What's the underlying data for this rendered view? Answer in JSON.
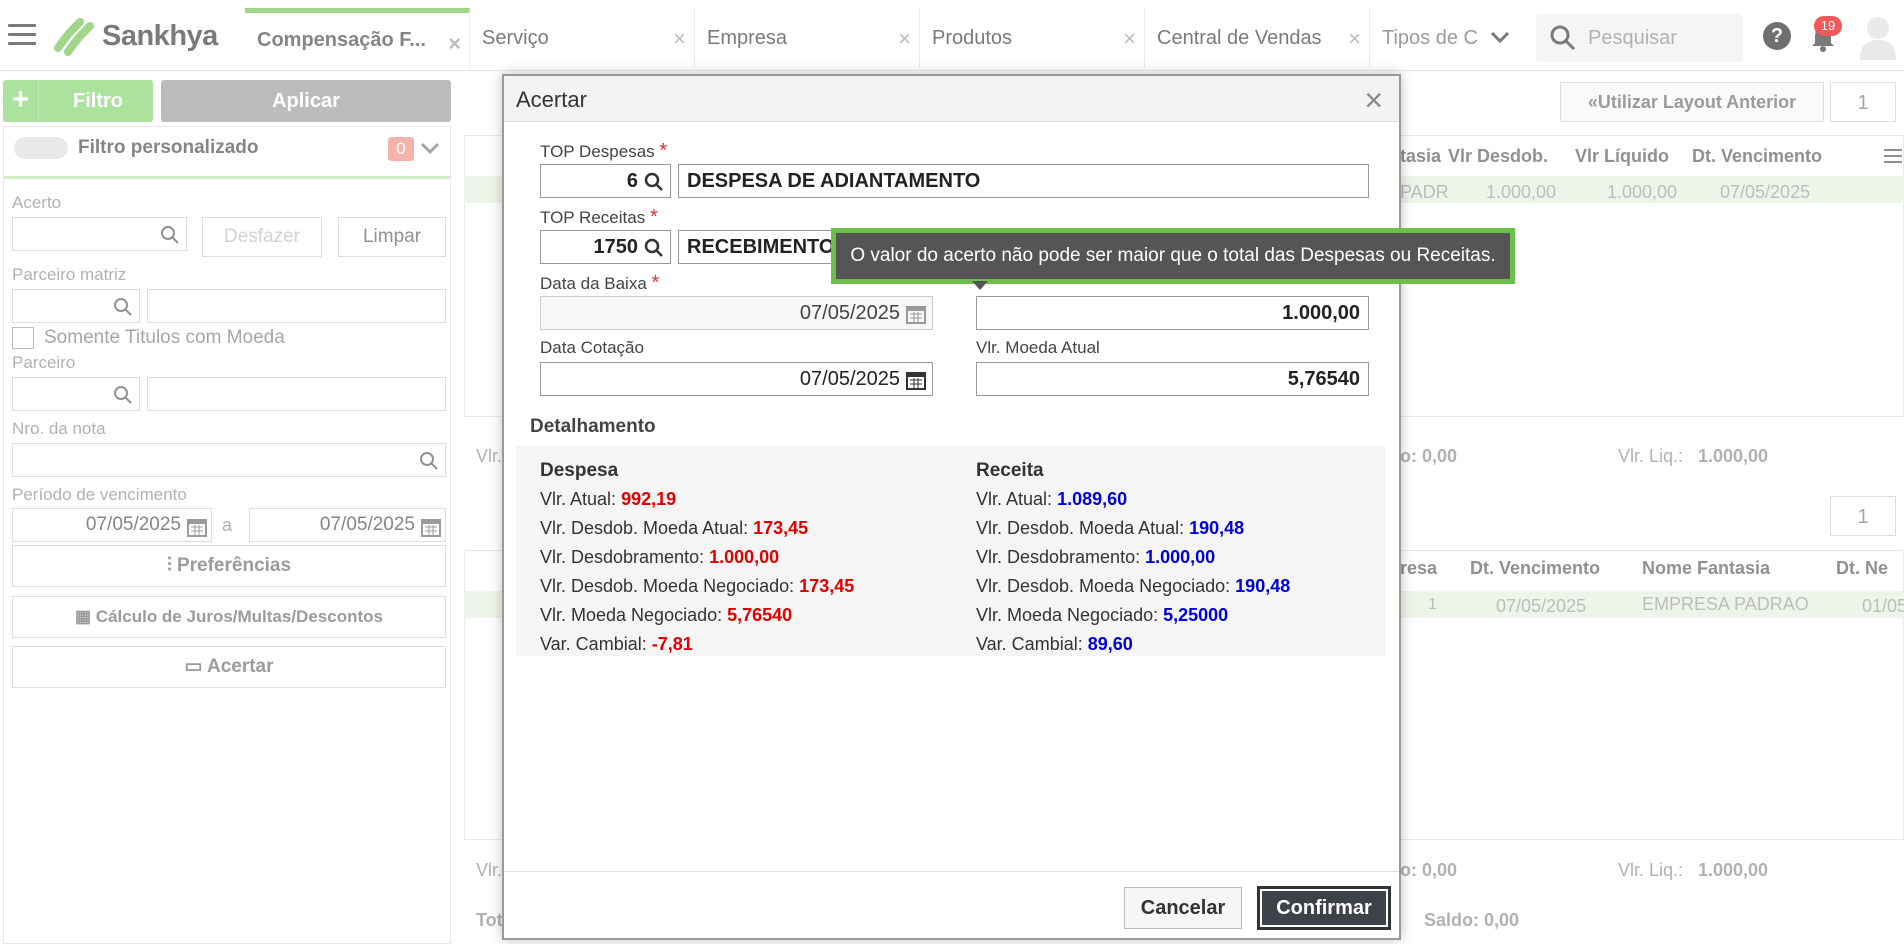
{
  "app": {
    "name": "Sankhya",
    "notifications_count": "19",
    "search_placeholder": "Pesquisar"
  },
  "tabs": [
    {
      "label": "Compensação F..."
    },
    {
      "label": "Serviço"
    },
    {
      "label": "Empresa"
    },
    {
      "label": "Produtos"
    },
    {
      "label": "Central de Vendas"
    },
    {
      "label": "Tipos de C"
    }
  ],
  "filter_panel": {
    "filter_button": "Filtro",
    "apply_button": "Aplicar",
    "custom_filter_label": "Filtro personalizado",
    "custom_filter_count": "0",
    "acerto_label": "Acerto",
    "undo_button": "Desfazer",
    "clear_button": "Limpar",
    "parceiro_matriz_label": "Parceiro matriz",
    "somente_titulos_label": "Somente Titulos com Moeda",
    "parceiro_label": "Parceiro",
    "nro_nota_label": "Nro. da nota",
    "periodo_label": "Período de vencimento",
    "periodo_from": "07/05/2025",
    "periodo_sep": "a",
    "periodo_to": "07/05/2025",
    "preferences_button": "Preferências",
    "calc_button": "Cálculo de Juros/Multas/Descontos",
    "acertar_button": "Acertar"
  },
  "background": {
    "layout_button": "Utilizar Layout Anterior",
    "page_number_top": "1",
    "page_number_bottom": "1",
    "top_grid_headers": [
      "tasia",
      "Vlr Desdob.",
      "Vlr Líquido",
      "Dt. Vencimento"
    ],
    "top_grid_row": [
      "PADR",
      "1.000,00",
      "1.000,00",
      "07/05/2025"
    ],
    "top_totals": {
      "partial": "o: 0,00",
      "liq_label": "Vlr. Liq.:",
      "liq_value": "1.000,00"
    },
    "bottom_grid_headers": [
      "resa",
      "Dt. Vencimento",
      "Nome Fantasia",
      "Dt. Ne"
    ],
    "bottom_grid_row": [
      "1",
      "07/05/2025",
      "EMPRESA PADRAO",
      "01/05"
    ],
    "bottom_totals": {
      "partial": "o: 0,00",
      "liq_label": "Vlr. Liq.:",
      "liq_value": "1.000,00"
    },
    "left_cut_vlr_top": "Vlr.",
    "left_cut_vlr_bottom": "Vlr.",
    "left_cut_tot": "Tot",
    "saldo": "Saldo: 0,00"
  },
  "modal": {
    "title": "Acertar",
    "top_despesas_label": "TOP Despesas",
    "top_despesas_code": "6",
    "top_despesas_desc": "DESPESA DE ADIANTAMENTO",
    "top_receitas_label": "TOP Receitas",
    "top_receitas_code": "1750",
    "top_receitas_desc": "RECEBIMENTO",
    "data_baixa_label": "Data da Baixa",
    "data_baixa_value": "07/05/2025",
    "valor_value": "1.000,00",
    "data_cotacao_label": "Data Cotação",
    "data_cotacao_value": "07/05/2025",
    "vlr_moeda_label": "Vlr. Moeda Atual",
    "vlr_moeda_value": "5,76540",
    "detalhamento_label": "Detalhamento",
    "despesa": {
      "heading": "Despesa",
      "rows": [
        {
          "label": "Vlr. Atual:",
          "value": "992,19"
        },
        {
          "label": "Vlr. Desdob. Moeda Atual:",
          "value": "173,45"
        },
        {
          "label": "Vlr. Desdobramento:",
          "value": "1.000,00"
        },
        {
          "label": "Vlr. Desdob. Moeda Negociado:",
          "value": "173,45"
        },
        {
          "label": "Vlr. Moeda Negociado:",
          "value": "5,76540"
        },
        {
          "label": "Var. Cambial:",
          "value": "-7,81"
        }
      ]
    },
    "receita": {
      "heading": "Receita",
      "rows": [
        {
          "label": "Vlr. Atual:",
          "value": "1.089,60"
        },
        {
          "label": "Vlr. Desdob. Moeda Atual:",
          "value": "190,48"
        },
        {
          "label": "Vlr. Desdobramento:",
          "value": "1.000,00"
        },
        {
          "label": "Vlr. Desdob. Moeda Negociado:",
          "value": "190,48"
        },
        {
          "label": "Vlr. Moeda Negociado:",
          "value": "5,25000"
        },
        {
          "label": "Var. Cambial:",
          "value": "89,60"
        }
      ]
    },
    "tooltip": "O valor do acerto não pode ser maior que o total das Despesas ou Receitas.",
    "cancel_button": "Cancelar",
    "confirm_button": "Confirmar"
  },
  "colors": {
    "brand_green": "#6cc04a",
    "negative_red": "#e00000",
    "positive_blue": "#0000dd"
  }
}
